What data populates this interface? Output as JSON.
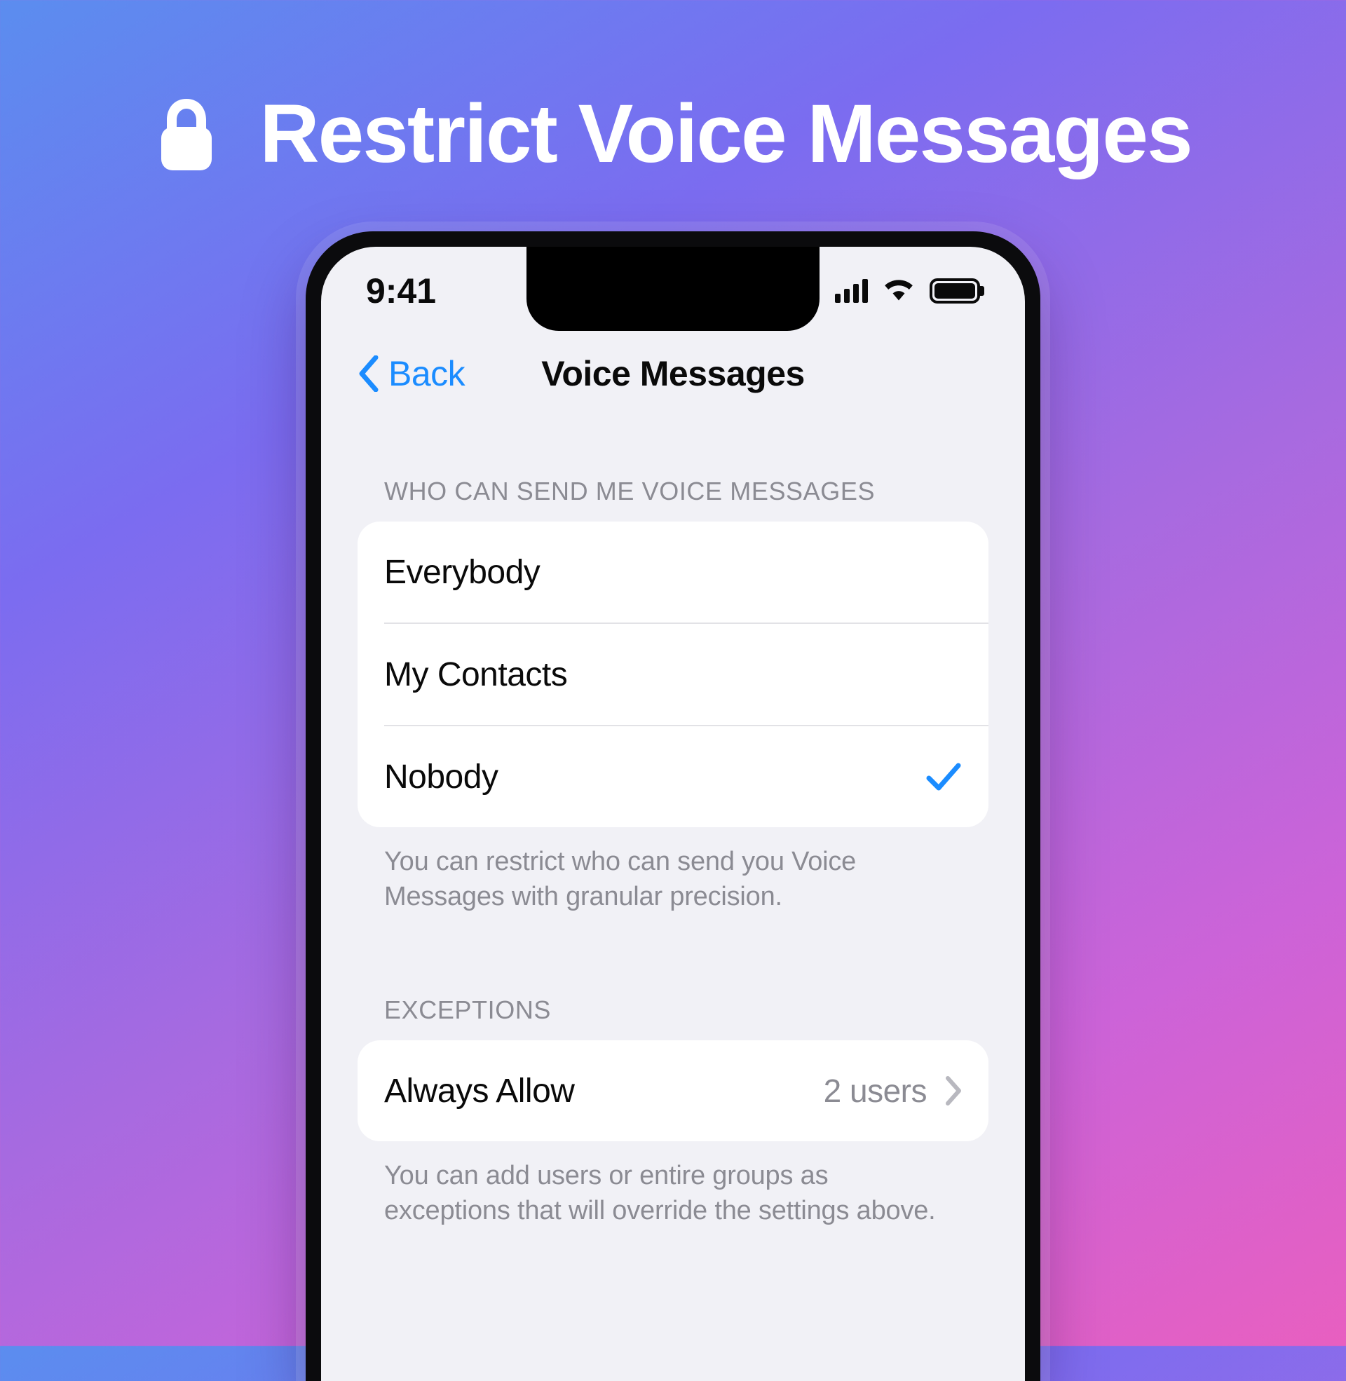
{
  "headline": {
    "icon": "lock-icon",
    "text": "Restrict Voice Messages"
  },
  "phone": {
    "status_bar": {
      "time": "9:41",
      "icons": [
        "cellular-signal-icon",
        "wifi-icon",
        "battery-icon"
      ]
    },
    "nav_bar": {
      "back_label": "Back",
      "back_icon": "chevron-left-icon",
      "title": "Voice Messages"
    },
    "sections": [
      {
        "header": "WHO CAN SEND ME VOICE MESSAGES",
        "rows": [
          {
            "label": "Everybody",
            "selected": false
          },
          {
            "label": "My Contacts",
            "selected": false
          },
          {
            "label": "Nobody",
            "selected": true
          }
        ],
        "footnote": "You can restrict who can send you Voice Messages with granular precision."
      },
      {
        "header": "EXCEPTIONS",
        "rows": [
          {
            "label": "Always Allow",
            "value": "2 users",
            "disclosure": true
          }
        ],
        "footnote": "You can add users or entire groups as exceptions that will override the settings above."
      }
    ]
  },
  "colors": {
    "accent_blue": "#1b8cff",
    "text_primary": "#0a0a0a",
    "text_secondary": "#8b8b93",
    "screen_bg": "#f1f1f6",
    "card_bg": "#ffffff"
  }
}
